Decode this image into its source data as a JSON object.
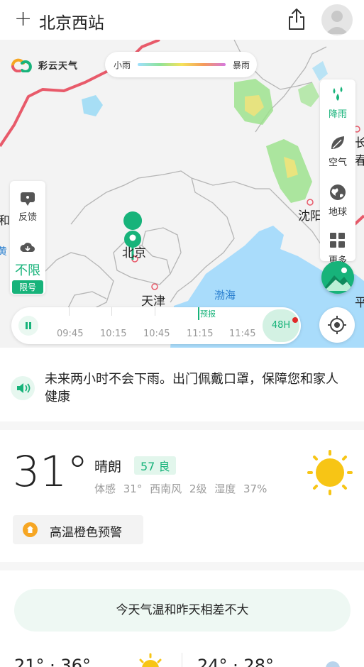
{
  "header": {
    "title": "北京西站",
    "plus_icon": "plus-icon",
    "share_icon": "share-icon",
    "avatar_icon": "avatar-icon"
  },
  "map": {
    "brand": "彩云天气",
    "legend": {
      "low": "小雨",
      "high": "暴雨"
    },
    "places": {
      "beijing": "北京",
      "tianjin": "天津",
      "bohai": "渤海",
      "shenyang": "沈阳",
      "huhe_partial": "呼和",
      "changchun_partial": "长春",
      "ping_partial": "平",
      "huang_partial": "黄"
    },
    "left_panel": {
      "feedback": "反馈",
      "xianxing": "不限",
      "xianxing_tag": "限号"
    },
    "right_panel": {
      "rain": "降雨",
      "air": "空气",
      "earth": "地球",
      "more": "更多"
    },
    "timeline": {
      "ticks": [
        "09:45",
        "10:15",
        "10:45",
        "11:15",
        "11:45"
      ],
      "forecast_label": "预报",
      "button": "48H"
    }
  },
  "notice": {
    "text": "未来两小时不会下雨。出门佩戴口罩，保障您和家人健康"
  },
  "current": {
    "temperature": "31°",
    "condition": "晴朗",
    "aqi": "57 良",
    "feels_like": "体感 31°",
    "wind": "西南风 2级",
    "humidity": "湿度 37%",
    "warning": "高温橙色预警"
  },
  "compare": "今天气温和昨天相差不大",
  "days": {
    "today_range": "21° · 36°",
    "tomorrow_range": "24° · 28°"
  },
  "colors": {
    "accent": "#17b37a",
    "sea": "#a9dcfb",
    "border_red": "#e85a6a",
    "warning": "#f6a623",
    "sun": "#f7c515"
  }
}
